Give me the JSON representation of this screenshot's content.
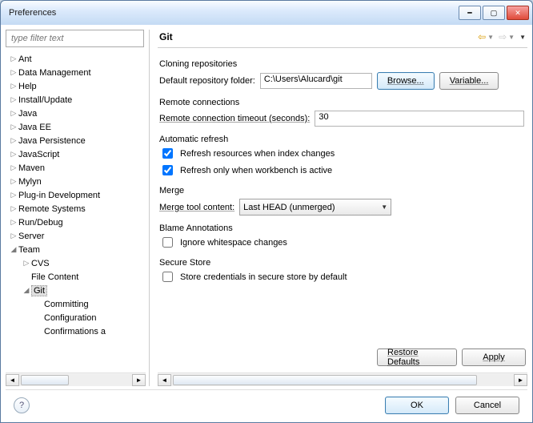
{
  "window": {
    "title": "Preferences"
  },
  "filter": {
    "placeholder": "type filter text"
  },
  "tree": [
    {
      "label": "Ant",
      "depth": 0,
      "expand": "▷"
    },
    {
      "label": "Data Management",
      "depth": 0,
      "expand": "▷"
    },
    {
      "label": "Help",
      "depth": 0,
      "expand": "▷"
    },
    {
      "label": "Install/Update",
      "depth": 0,
      "expand": "▷"
    },
    {
      "label": "Java",
      "depth": 0,
      "expand": "▷"
    },
    {
      "label": "Java EE",
      "depth": 0,
      "expand": "▷"
    },
    {
      "label": "Java Persistence",
      "depth": 0,
      "expand": "▷"
    },
    {
      "label": "JavaScript",
      "depth": 0,
      "expand": "▷"
    },
    {
      "label": "Maven",
      "depth": 0,
      "expand": "▷"
    },
    {
      "label": "Mylyn",
      "depth": 0,
      "expand": "▷"
    },
    {
      "label": "Plug-in Development",
      "depth": 0,
      "expand": "▷"
    },
    {
      "label": "Remote Systems",
      "depth": 0,
      "expand": "▷"
    },
    {
      "label": "Run/Debug",
      "depth": 0,
      "expand": "▷"
    },
    {
      "label": "Server",
      "depth": 0,
      "expand": "▷"
    },
    {
      "label": "Team",
      "depth": 0,
      "expand": "◢"
    },
    {
      "label": "CVS",
      "depth": 1,
      "expand": "▷"
    },
    {
      "label": "File Content",
      "depth": 1,
      "expand": ""
    },
    {
      "label": "Git",
      "depth": 1,
      "expand": "◢",
      "selected": true
    },
    {
      "label": "Committing",
      "depth": 2,
      "expand": ""
    },
    {
      "label": "Configuration",
      "depth": 2,
      "expand": ""
    },
    {
      "label": "Confirmations a",
      "depth": 2,
      "expand": ""
    }
  ],
  "page": {
    "title": "Git",
    "cloning": {
      "heading": "Cloning repositories",
      "folder_label": "Default repository folder:",
      "folder_value": "C:\\Users\\Alucard\\git",
      "browse_btn": "Browse...",
      "variable_btn": "Variable..."
    },
    "remote": {
      "heading": "Remote connections",
      "timeout_label": "Remote connection timeout (seconds):",
      "timeout_value": "30"
    },
    "auto": {
      "heading": "Automatic refresh",
      "chk1": "Refresh resources when index changes",
      "chk2": "Refresh only when workbench is active"
    },
    "merge": {
      "heading": "Merge",
      "label": "Merge tool content:",
      "value": "Last HEAD (unmerged)"
    },
    "blame": {
      "heading": "Blame Annotations",
      "chk": "Ignore whitespace changes"
    },
    "secure": {
      "heading": "Secure Store",
      "chk": "Store credentials in secure store by default"
    },
    "restore_btn": "Restore Defaults",
    "apply_btn": "Apply"
  },
  "buttons": {
    "ok": "OK",
    "cancel": "Cancel"
  }
}
